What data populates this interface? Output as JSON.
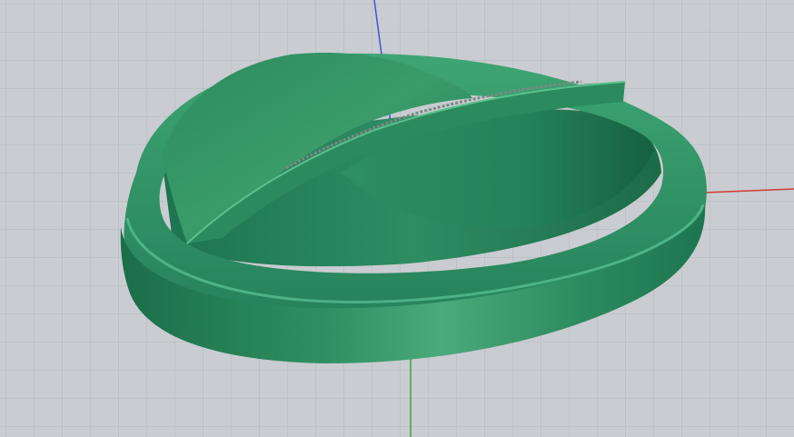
{
  "viewport": {
    "view": "perspective",
    "background_color": "#c9ccd0",
    "grid_visible": true,
    "grid_color": "#b3b7bc",
    "axes": {
      "x_axis_color": "#d23a32",
      "y_axis_color": "#38a63a",
      "z_axis_color": "#4b4fd8"
    }
  },
  "model": {
    "object": "crossover-ring",
    "material_color": "#2a8a5f",
    "highlight_color": "#56bf8c",
    "shadow_color": "#145c3c",
    "shading": "rendered"
  }
}
